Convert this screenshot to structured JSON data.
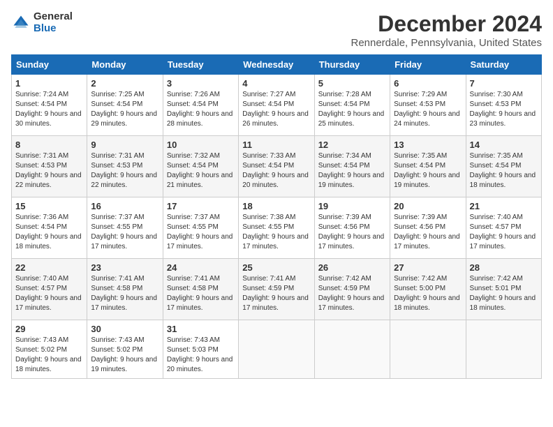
{
  "header": {
    "logo_general": "General",
    "logo_blue": "Blue",
    "month_title": "December 2024",
    "location": "Rennerdale, Pennsylvania, United States"
  },
  "weekdays": [
    "Sunday",
    "Monday",
    "Tuesday",
    "Wednesday",
    "Thursday",
    "Friday",
    "Saturday"
  ],
  "weeks": [
    [
      {
        "day": "1",
        "sunrise": "7:24 AM",
        "sunset": "4:54 PM",
        "daylight": "9 hours and 30 minutes."
      },
      {
        "day": "2",
        "sunrise": "7:25 AM",
        "sunset": "4:54 PM",
        "daylight": "9 hours and 29 minutes."
      },
      {
        "day": "3",
        "sunrise": "7:26 AM",
        "sunset": "4:54 PM",
        "daylight": "9 hours and 28 minutes."
      },
      {
        "day": "4",
        "sunrise": "7:27 AM",
        "sunset": "4:54 PM",
        "daylight": "9 hours and 26 minutes."
      },
      {
        "day": "5",
        "sunrise": "7:28 AM",
        "sunset": "4:54 PM",
        "daylight": "9 hours and 25 minutes."
      },
      {
        "day": "6",
        "sunrise": "7:29 AM",
        "sunset": "4:53 PM",
        "daylight": "9 hours and 24 minutes."
      },
      {
        "day": "7",
        "sunrise": "7:30 AM",
        "sunset": "4:53 PM",
        "daylight": "9 hours and 23 minutes."
      }
    ],
    [
      {
        "day": "8",
        "sunrise": "7:31 AM",
        "sunset": "4:53 PM",
        "daylight": "9 hours and 22 minutes."
      },
      {
        "day": "9",
        "sunrise": "7:31 AM",
        "sunset": "4:53 PM",
        "daylight": "9 hours and 22 minutes."
      },
      {
        "day": "10",
        "sunrise": "7:32 AM",
        "sunset": "4:54 PM",
        "daylight": "9 hours and 21 minutes."
      },
      {
        "day": "11",
        "sunrise": "7:33 AM",
        "sunset": "4:54 PM",
        "daylight": "9 hours and 20 minutes."
      },
      {
        "day": "12",
        "sunrise": "7:34 AM",
        "sunset": "4:54 PM",
        "daylight": "9 hours and 19 minutes."
      },
      {
        "day": "13",
        "sunrise": "7:35 AM",
        "sunset": "4:54 PM",
        "daylight": "9 hours and 19 minutes."
      },
      {
        "day": "14",
        "sunrise": "7:35 AM",
        "sunset": "4:54 PM",
        "daylight": "9 hours and 18 minutes."
      }
    ],
    [
      {
        "day": "15",
        "sunrise": "7:36 AM",
        "sunset": "4:54 PM",
        "daylight": "9 hours and 18 minutes."
      },
      {
        "day": "16",
        "sunrise": "7:37 AM",
        "sunset": "4:55 PM",
        "daylight": "9 hours and 17 minutes."
      },
      {
        "day": "17",
        "sunrise": "7:37 AM",
        "sunset": "4:55 PM",
        "daylight": "9 hours and 17 minutes."
      },
      {
        "day": "18",
        "sunrise": "7:38 AM",
        "sunset": "4:55 PM",
        "daylight": "9 hours and 17 minutes."
      },
      {
        "day": "19",
        "sunrise": "7:39 AM",
        "sunset": "4:56 PM",
        "daylight": "9 hours and 17 minutes."
      },
      {
        "day": "20",
        "sunrise": "7:39 AM",
        "sunset": "4:56 PM",
        "daylight": "9 hours and 17 minutes."
      },
      {
        "day": "21",
        "sunrise": "7:40 AM",
        "sunset": "4:57 PM",
        "daylight": "9 hours and 17 minutes."
      }
    ],
    [
      {
        "day": "22",
        "sunrise": "7:40 AM",
        "sunset": "4:57 PM",
        "daylight": "9 hours and 17 minutes."
      },
      {
        "day": "23",
        "sunrise": "7:41 AM",
        "sunset": "4:58 PM",
        "daylight": "9 hours and 17 minutes."
      },
      {
        "day": "24",
        "sunrise": "7:41 AM",
        "sunset": "4:58 PM",
        "daylight": "9 hours and 17 minutes."
      },
      {
        "day": "25",
        "sunrise": "7:41 AM",
        "sunset": "4:59 PM",
        "daylight": "9 hours and 17 minutes."
      },
      {
        "day": "26",
        "sunrise": "7:42 AM",
        "sunset": "4:59 PM",
        "daylight": "9 hours and 17 minutes."
      },
      {
        "day": "27",
        "sunrise": "7:42 AM",
        "sunset": "5:00 PM",
        "daylight": "9 hours and 18 minutes."
      },
      {
        "day": "28",
        "sunrise": "7:42 AM",
        "sunset": "5:01 PM",
        "daylight": "9 hours and 18 minutes."
      }
    ],
    [
      {
        "day": "29",
        "sunrise": "7:43 AM",
        "sunset": "5:02 PM",
        "daylight": "9 hours and 18 minutes."
      },
      {
        "day": "30",
        "sunrise": "7:43 AM",
        "sunset": "5:02 PM",
        "daylight": "9 hours and 19 minutes."
      },
      {
        "day": "31",
        "sunrise": "7:43 AM",
        "sunset": "5:03 PM",
        "daylight": "9 hours and 20 minutes."
      },
      null,
      null,
      null,
      null
    ]
  ]
}
